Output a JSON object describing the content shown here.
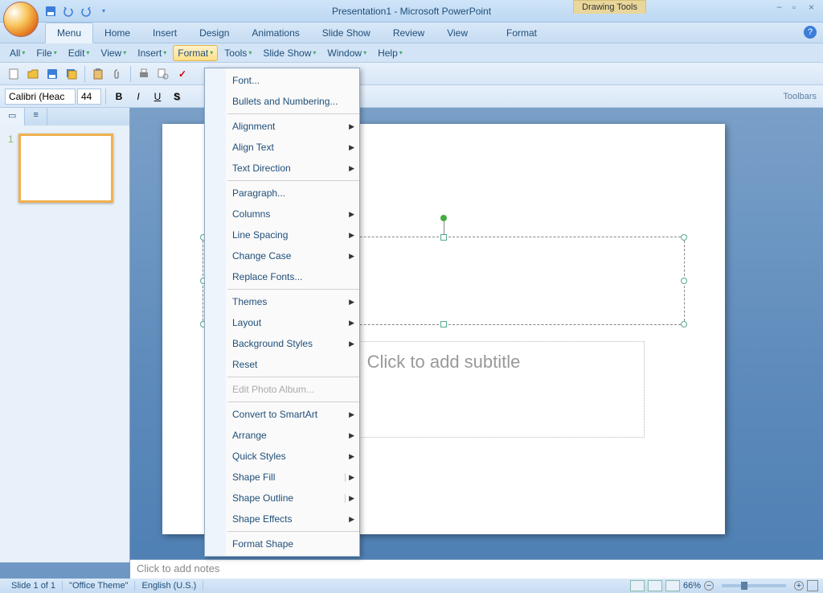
{
  "titlebar": {
    "title": "Presentation1 - Microsoft PowerPoint",
    "context_tab": "Drawing Tools"
  },
  "ribbon_tabs": [
    "Menu",
    "Home",
    "Insert",
    "Design",
    "Animations",
    "Slide Show",
    "Review",
    "View",
    "Format"
  ],
  "ribbon_active": "Menu",
  "classic_menu": [
    "All",
    "File",
    "Edit",
    "View",
    "Insert",
    "Format",
    "Tools",
    "Slide Show",
    "Window",
    "Help"
  ],
  "classic_open": "Format",
  "toolbar_label": "Toolbars",
  "font": {
    "name": "Calibri (Heac",
    "size": "44"
  },
  "format_menu": [
    {
      "label": "Font...",
      "icon": "font-icon",
      "sub": false
    },
    {
      "label": "Bullets and Numbering...",
      "icon": "bullets-icon",
      "sub": false
    },
    {
      "sep": true
    },
    {
      "label": "Alignment",
      "icon": "align-icon",
      "sub": true
    },
    {
      "label": "Align Text",
      "icon": "align-text-icon",
      "sub": true
    },
    {
      "label": "Text Direction",
      "icon": "text-dir-icon",
      "sub": true
    },
    {
      "sep": true
    },
    {
      "label": "Paragraph...",
      "icon": "paragraph-icon",
      "sub": false
    },
    {
      "label": "Columns",
      "icon": "columns-icon",
      "sub": true
    },
    {
      "label": "Line Spacing",
      "icon": "line-spacing-icon",
      "sub": true
    },
    {
      "label": "Change Case",
      "icon": "change-case-icon",
      "sub": true
    },
    {
      "label": "Replace Fonts...",
      "icon": "replace-fonts-icon",
      "sub": false
    },
    {
      "sep": true
    },
    {
      "label": "Themes",
      "icon": "themes-icon",
      "sub": true
    },
    {
      "label": "Layout",
      "icon": "layout-icon",
      "sub": true
    },
    {
      "label": "Background Styles",
      "icon": "background-icon",
      "sub": true
    },
    {
      "label": "Reset",
      "icon": "reset-icon",
      "sub": false
    },
    {
      "sep": true
    },
    {
      "label": "Edit Photo Album...",
      "icon": "photo-album-icon",
      "sub": false,
      "disabled": true
    },
    {
      "sep": true
    },
    {
      "label": "Convert to SmartArt",
      "icon": "smartart-icon",
      "sub": true
    },
    {
      "label": "Arrange",
      "icon": "arrange-icon",
      "sub": true
    },
    {
      "label": "Quick Styles",
      "icon": "quick-styles-icon",
      "sub": true
    },
    {
      "label": "Shape Fill",
      "icon": "shape-fill-icon",
      "sub": true,
      "split": true
    },
    {
      "label": "Shape Outline",
      "icon": "shape-outline-icon",
      "sub": true,
      "split": true
    },
    {
      "label": "Shape Effects",
      "icon": "shape-effects-icon",
      "sub": true
    },
    {
      "sep": true
    },
    {
      "label": "Format Shape",
      "icon": "format-shape-icon",
      "sub": false
    }
  ],
  "slide": {
    "subtitle_placeholder": "Click to add subtitle",
    "notes_placeholder": "Click to add notes",
    "thumb_number": "1"
  },
  "statusbar": {
    "slide_info": "Slide 1 of 1",
    "theme": "\"Office Theme\"",
    "language": "English (U.S.)",
    "zoom": "66%"
  }
}
